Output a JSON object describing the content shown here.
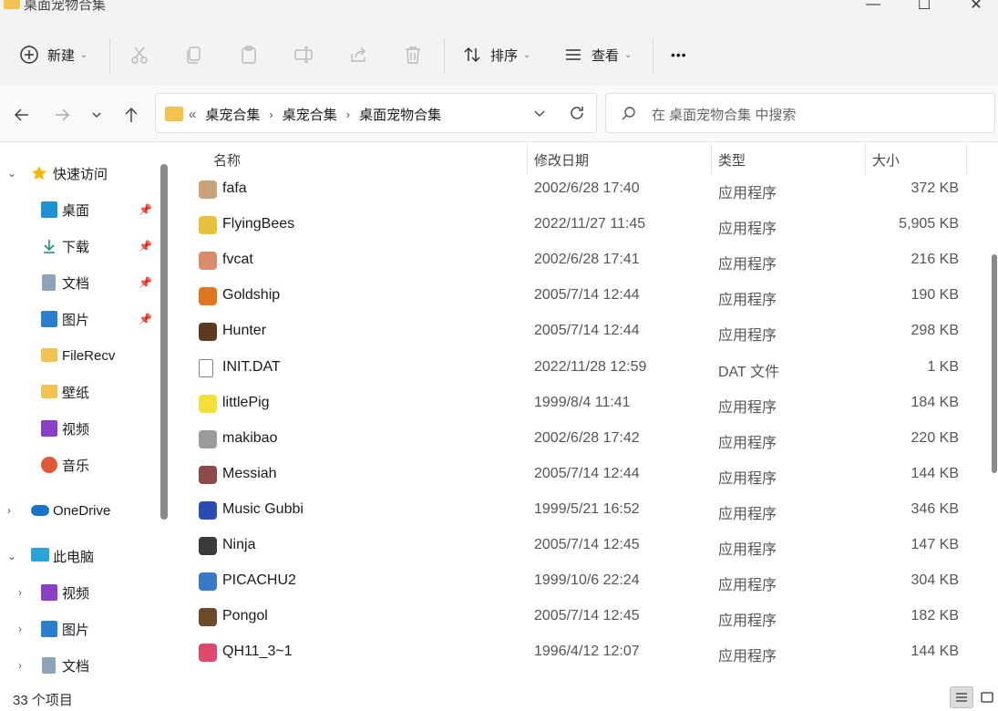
{
  "window": {
    "title": "桌面宠物合集",
    "controls": {
      "minimize": "—",
      "maximize": "☐",
      "close": "✕"
    }
  },
  "toolbar": {
    "new_label": "新建",
    "sort_label": "排序",
    "view_label": "查看",
    "more_label": "•••"
  },
  "address": {
    "overflow": "«",
    "breadcrumbs": [
      "桌宠合集",
      "桌宠合集",
      "桌面宠物合集"
    ],
    "search_placeholder": "在 桌面宠物合集 中搜索"
  },
  "sidebar": {
    "quick_access": "快速访问",
    "items": [
      {
        "label": "桌面",
        "icon": "desktop-icon",
        "pinned": true
      },
      {
        "label": "下载",
        "icon": "download-icon",
        "pinned": true
      },
      {
        "label": "文档",
        "icon": "document-icon",
        "pinned": true
      },
      {
        "label": "图片",
        "icon": "picture-icon",
        "pinned": true
      },
      {
        "label": "FileRecv",
        "icon": "folder-icon",
        "pinned": false
      },
      {
        "label": "壁纸",
        "icon": "folder-icon",
        "pinned": false
      },
      {
        "label": "视频",
        "icon": "video-icon",
        "pinned": false
      },
      {
        "label": "音乐",
        "icon": "music-icon",
        "pinned": false
      }
    ],
    "onedrive": "OneDrive",
    "this_pc": "此电脑",
    "pc_items": [
      {
        "label": "视频",
        "icon": "video-icon"
      },
      {
        "label": "图片",
        "icon": "picture-icon"
      },
      {
        "label": "文档",
        "icon": "document-icon"
      }
    ]
  },
  "list": {
    "columns": {
      "name": "名称",
      "date": "修改日期",
      "type": "类型",
      "size": "大小"
    },
    "rows": [
      {
        "name": "fafa",
        "date": "2002/6/28 17:40",
        "type": "应用程序",
        "size": "372 KB",
        "icon_color": "#c9a27a"
      },
      {
        "name": "FlyingBees",
        "date": "2022/11/27 11:45",
        "type": "应用程序",
        "size": "5,905 KB",
        "icon_color": "#e8c13c"
      },
      {
        "name": "fvcat",
        "date": "2002/6/28 17:41",
        "type": "应用程序",
        "size": "216 KB",
        "icon_color": "#d98c6b"
      },
      {
        "name": "Goldship",
        "date": "2005/7/14 12:44",
        "type": "应用程序",
        "size": "190 KB",
        "icon_color": "#e0761f"
      },
      {
        "name": "Hunter",
        "date": "2005/7/14 12:44",
        "type": "应用程序",
        "size": "298 KB",
        "icon_color": "#5a3b1f"
      },
      {
        "name": "INIT.DAT",
        "date": "2022/11/28 12:59",
        "type": "DAT 文件",
        "size": "1 KB",
        "icon_color": "#ffffff"
      },
      {
        "name": "littlePig",
        "date": "1999/8/4 11:41",
        "type": "应用程序",
        "size": "184 KB",
        "icon_color": "#f1e03a"
      },
      {
        "name": "makibao",
        "date": "2002/6/28 17:42",
        "type": "应用程序",
        "size": "220 KB",
        "icon_color": "#9a9a9a"
      },
      {
        "name": "Messiah",
        "date": "2005/7/14 12:44",
        "type": "应用程序",
        "size": "144 KB",
        "icon_color": "#8c4a4a"
      },
      {
        "name": "Music Gubbi",
        "date": "1999/5/21 16:52",
        "type": "应用程序",
        "size": "346 KB",
        "icon_color": "#2a4bb0"
      },
      {
        "name": "Ninja",
        "date": "2005/7/14 12:45",
        "type": "应用程序",
        "size": "147 KB",
        "icon_color": "#3a3a3a"
      },
      {
        "name": "PICACHU2",
        "date": "1999/10/6 22:24",
        "type": "应用程序",
        "size": "304 KB",
        "icon_color": "#3c78c8"
      },
      {
        "name": "Pongol",
        "date": "2005/7/14 12:45",
        "type": "应用程序",
        "size": "182 KB",
        "icon_color": "#6b4a2a"
      },
      {
        "name": "QH11_3~1",
        "date": "1996/4/12 12:07",
        "type": "应用程序",
        "size": "144 KB",
        "icon_color": "#e04a6a"
      }
    ]
  },
  "status": {
    "count": "33 个项目"
  }
}
